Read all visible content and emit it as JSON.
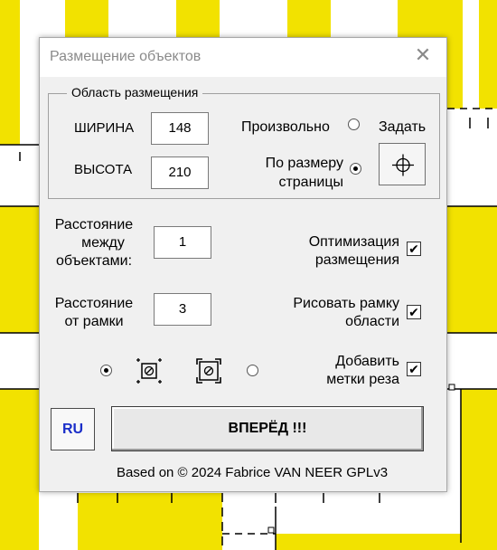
{
  "dialog": {
    "title": "Размещение объектов",
    "close_label": "✕"
  },
  "placement_area": {
    "legend": "Область размещения",
    "width_label": "ШИРИНА",
    "width_value": "148",
    "height_label": "ВЫСОТА",
    "height_value": "210",
    "custom_label": "Произвольно",
    "custom_selected": false,
    "page_size_label_line1": "По размеру",
    "page_size_label_line2": "страницы",
    "page_size_selected": true,
    "set_label": "Задать"
  },
  "spacing": {
    "between_label_line1": "Расстояние",
    "between_label_line2": "между",
    "between_label_line3": "объектами:",
    "between_value": "1",
    "frame_label_line1": "Расстояние",
    "frame_label_line2": "от рамки",
    "frame_value": "3"
  },
  "options": {
    "optimize_line1": "Оптимизация",
    "optimize_line2": "размещения",
    "optimize_checked": true,
    "draw_frame_line1": "Рисовать рамку",
    "draw_frame_line2": "области",
    "draw_frame_checked": true,
    "cut_marks_line1": "Добавить",
    "cut_marks_line2": "метки реза",
    "cut_marks_checked": true,
    "checkmark": "✔"
  },
  "mode": {
    "first_selected": true,
    "second_selected": false
  },
  "buttons": {
    "ru_label": "RU",
    "go_label": "ВПЕРЁД !!!"
  },
  "footer": {
    "text": "Based on © 2024 Fabrice VAN NEER GPLv3"
  },
  "colors": {
    "yellow": "#f2e200",
    "ru_text": "#1a2ec9"
  }
}
